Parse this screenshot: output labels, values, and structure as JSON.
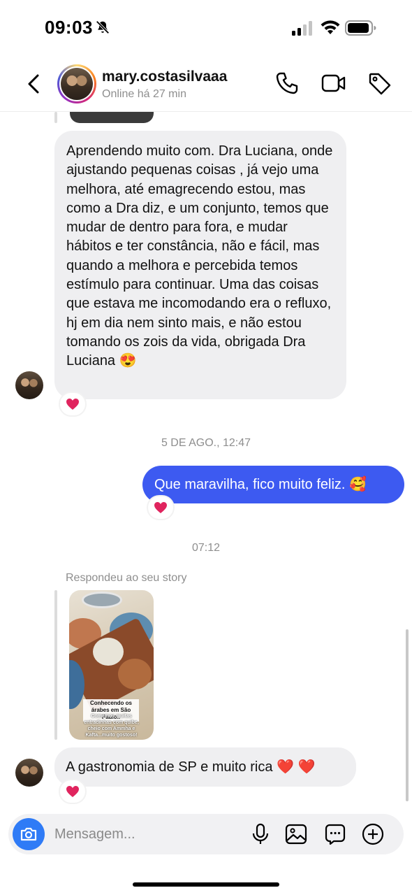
{
  "status_bar": {
    "time": "09:03"
  },
  "header": {
    "username": "mary.costasilvaaa",
    "status": "Online há 27 min"
  },
  "messages": {
    "received_1": "Aprendendo muito com. Dra Luciana, onde ajustando pequenas coisas , já vejo uma melhora, até emagrecendo estou, mas como a Dra diz, e um conjunto, temos que mudar de dentro para fora, e mudar hábitos e ter constância, não e fácil, mas quando a melhora e percebida temos estímulo para continuar. Uma das coisas que estava me incomodando era o refluxo, hj em dia nem sinto mais, e não estou tomando os zois da vida, obrigada Dra Luciana 😍",
    "timestamp_1": "5 DE AGO., 12:47",
    "sent_1": "Que maravilha, fico muito feliz. 🥰",
    "timestamp_2": "07:12",
    "story_reply_label": "Respondeu ao seu story",
    "story_title": "Conhecendo os árabes em São Paulo..",
    "story_caption": "Comemos muitas entradinhas com quibe, cheio com Ammha e Kafta...muito gostoso!",
    "received_2": "A gastronomia de SP e muito rica ❤️ ❤️"
  },
  "composer": {
    "placeholder": "Mensagem..."
  },
  "colors": {
    "sent_bubble": "#3d5af1",
    "received_bubble": "#efeff1",
    "camera_button": "#2f7bf6",
    "heart": "#e0245e"
  }
}
